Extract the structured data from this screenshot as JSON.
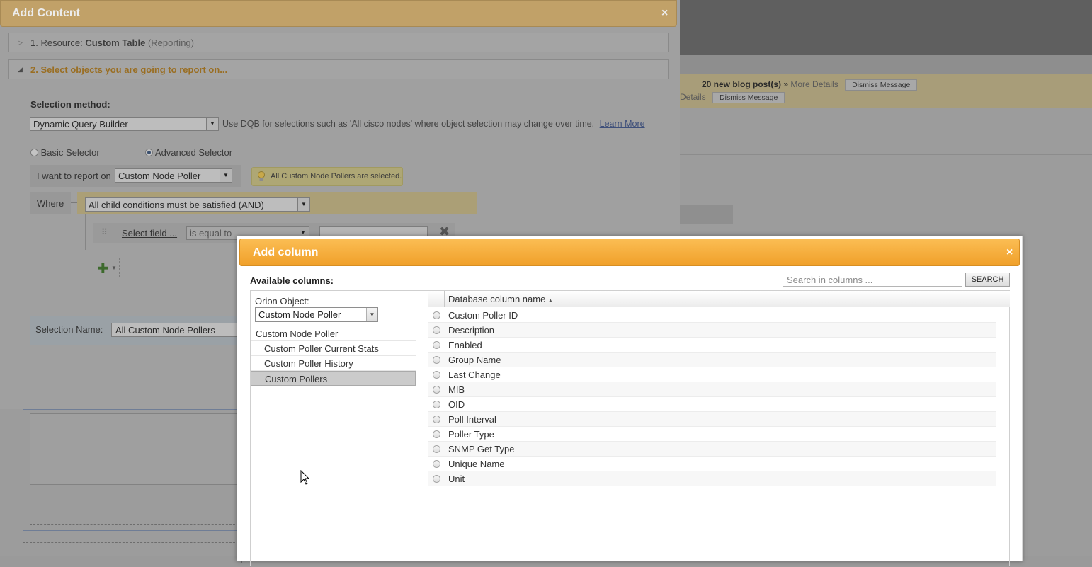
{
  "background": {
    "notice_1": {
      "text": "20 new blog post(s) »",
      "link": "More Details",
      "dismiss": "Dismiss Message"
    },
    "notice_2": {
      "link": "Details",
      "dismiss": "Dismiss Message"
    }
  },
  "add_content": {
    "title": "Add Content",
    "close": "×",
    "step1": {
      "prefix": "1. Resource:",
      "name": "Custom Table",
      "suffix": "(Reporting)"
    },
    "step2": {
      "label": "2. Select objects you are going to report on..."
    },
    "selection_method": {
      "label": "Selection method:",
      "value": "Dynamic Query Builder",
      "help": "Use DQB for selections such as 'All cisco nodes' where object selection may change over time.",
      "learn_more": "Learn More"
    },
    "selector": {
      "basic": "Basic Selector",
      "advanced": "Advanced Selector",
      "selected": "advanced"
    },
    "report_on": {
      "label": "I want to report on",
      "value": "Custom Node Poller"
    },
    "tip": "All Custom Node Pollers are selected.",
    "where": {
      "label": "Where",
      "condition": "All child conditions must be satisfied (AND)"
    },
    "condition_row": {
      "field": "Select field ...",
      "operator": "is equal to"
    },
    "selection_name": {
      "label": "Selection Name:",
      "value": "All Custom Node Pollers"
    }
  },
  "add_column": {
    "title": "Add column",
    "close": "×",
    "available_label": "Available columns:",
    "search": {
      "placeholder": "Search in columns ...",
      "button": "SEARCH"
    },
    "orion_object": {
      "label": "Orion Object:",
      "value": "Custom Node Poller"
    },
    "tree": [
      {
        "label": "Custom Node Poller",
        "level": 0,
        "selected": false
      },
      {
        "label": "Custom Poller Current Stats",
        "level": 1,
        "selected": false
      },
      {
        "label": "Custom Poller History",
        "level": 1,
        "selected": false
      },
      {
        "label": "Custom Pollers",
        "level": 1,
        "selected": true
      }
    ],
    "grid": {
      "column_header": "Database column name",
      "sort": "ascending",
      "rows": [
        "Custom Poller ID",
        "Description",
        "Enabled",
        "Group Name",
        "Last Change",
        "MIB",
        "OID",
        "Poll Interval",
        "Poller Type",
        "SNMP Get Type",
        "Unique Name",
        "Unit"
      ]
    }
  }
}
